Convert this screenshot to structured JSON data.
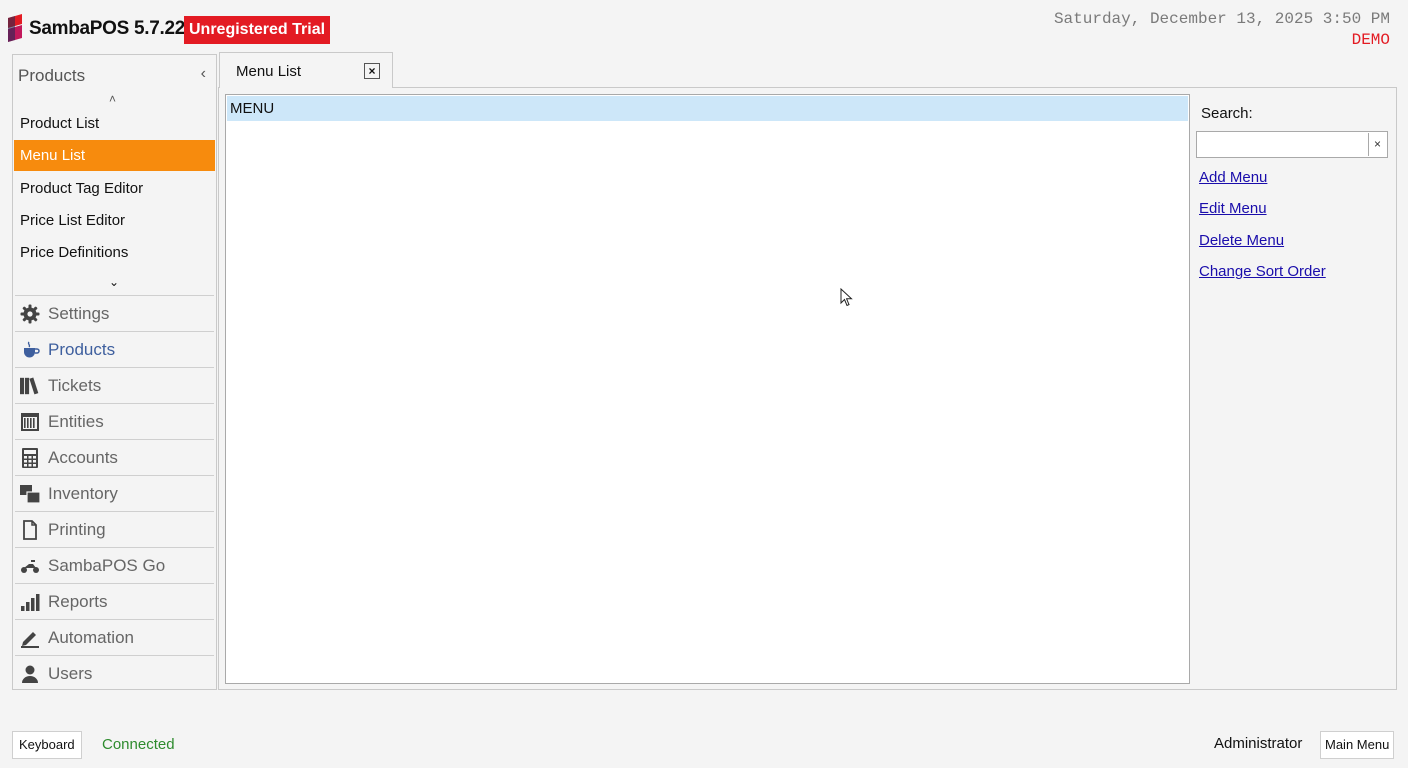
{
  "app": {
    "name": "SambaPOS 5.7.22",
    "trial_label": "Unregistered Trial",
    "datetime": "Saturday, December 13, 2025 3:50 PM",
    "mode": "DEMO",
    "brand_color": "#e31b23"
  },
  "left_panel": {
    "section_title": "Products",
    "collapse_icon": "chevron-left-icon",
    "sub_items": [
      {
        "label": "Product List",
        "active": false
      },
      {
        "label": "Menu List",
        "active": true
      },
      {
        "label": "Product Tag Editor",
        "active": false
      },
      {
        "label": "Price List Editor",
        "active": false
      },
      {
        "label": "Price Definitions",
        "active": false
      }
    ],
    "active_color": "#f78b0d",
    "nav": [
      {
        "label": "Settings",
        "icon": "gear-icon"
      },
      {
        "label": "Products",
        "icon": "coffee-cup-icon",
        "active": true
      },
      {
        "label": "Tickets",
        "icon": "books-icon"
      },
      {
        "label": "Entities",
        "icon": "entity-grid-icon"
      },
      {
        "label": "Accounts",
        "icon": "calculator-icon"
      },
      {
        "label": "Inventory",
        "icon": "inventory-icon"
      },
      {
        "label": "Printing",
        "icon": "document-icon"
      },
      {
        "label": "SambaPOS Go",
        "icon": "scooter-icon"
      },
      {
        "label": "Reports",
        "icon": "bar-chart-icon"
      },
      {
        "label": "Automation",
        "icon": "pencil-icon"
      },
      {
        "label": "Users",
        "icon": "user-icon"
      }
    ]
  },
  "tab": {
    "label": "Menu List",
    "close_glyph": "×"
  },
  "menu_list": {
    "rows": [
      "MENU"
    ],
    "selected_index": 0
  },
  "sidebar": {
    "search_label": "Search:",
    "search_value": "",
    "clear_glyph": "×",
    "links": [
      "Add Menu",
      "Edit Menu",
      "Delete Menu",
      "Change Sort Order"
    ]
  },
  "footer": {
    "keyboard_label": "Keyboard",
    "status": "Connected",
    "user": "Administrator",
    "main_menu_label": "Main Menu"
  }
}
